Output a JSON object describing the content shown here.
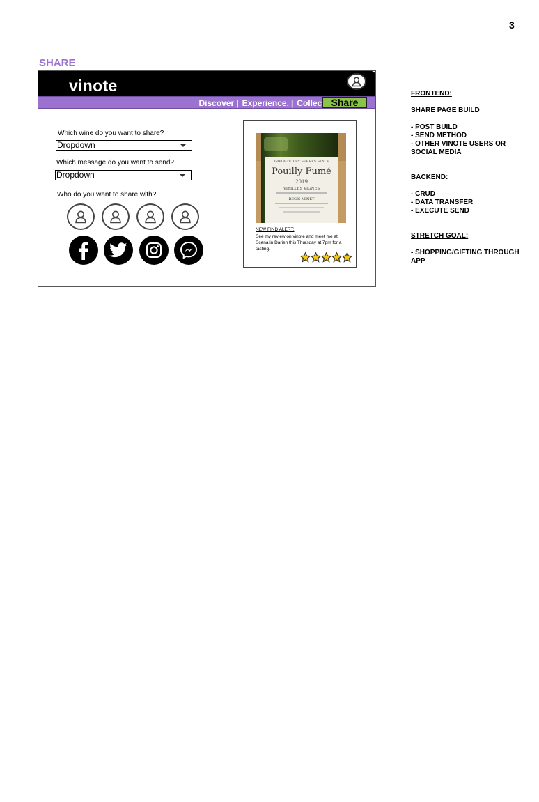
{
  "page_number": "3",
  "section_title": "SHARE",
  "app": {
    "logo": "vinote",
    "profile_icon": "user-icon",
    "nav": [
      "Discover",
      "Experience.",
      "Collect."
    ],
    "nav_separator": "|",
    "active_tab": "Share",
    "colors": {
      "header": "#000000",
      "nav": "#9b72cf",
      "active_tab": "#8bc34a"
    }
  },
  "form": {
    "wine_question": "Which wine do you want to share?",
    "wine_dropdown_value": "Dropdown",
    "message_question": "Which message do you want to send?",
    "message_dropdown_value": "Dropdown",
    "share_with_question": "Who do you want to share with?",
    "user_icons": [
      "user-icon",
      "user-icon",
      "user-icon",
      "user-icon"
    ],
    "social_icons": [
      "facebook-icon",
      "twitter-icon",
      "instagram-icon",
      "messenger-icon"
    ]
  },
  "preview_card": {
    "photo_label_lines": [
      "IMPORTED BY SERRES STYLE",
      "Pouilly Fumé",
      "2019",
      "VIEILLES VIGNES",
      "REGIS MINET"
    ],
    "alert_title": "NEW FIND ALERT:",
    "alert_text": "See my review on vinote and meet me at Scena in Darien this Thursday at 7pm for a tasting.",
    "rating": 5,
    "rating_max": 5
  },
  "notes": {
    "frontend_heading": "FRONTEND:",
    "frontend_items": [
      "SHARE PAGE BUILD",
      "- POST BUILD",
      "- SEND METHOD",
      "- OTHER VINOTE USERS OR SOCIAL MEDIA"
    ],
    "backend_heading": "BACKEND:",
    "backend_items": [
      "- CRUD",
      "- DATA TRANSFER",
      "- EXECUTE SEND"
    ],
    "stretch_heading": "STRETCH GOAL:",
    "stretch_items": [
      "- SHOPPING/GIFTING THROUGH APP"
    ]
  }
}
